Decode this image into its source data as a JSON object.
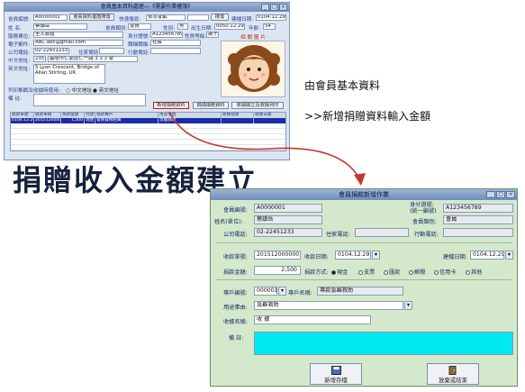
{
  "small_window": {
    "title": "會員基本資料處理---《需要作業權限》",
    "member_no_label": "會員編號:",
    "member_no": "A0000001",
    "query_button": "會員資料進階搜尋",
    "search_label": "快速搜尋:",
    "search_value": "依本會編",
    "edit_button": "搜尋",
    "created_label": "建檔日期:",
    "created_date": "0104.12.29",
    "name_label": "姓 名:",
    "name_value": "蔡鎮岳",
    "type_label": "會員類別:",
    "type_value": "會員",
    "gender_label": "性別:",
    "gender_value": "男",
    "birth_label": "出生日期:",
    "birth_value": "0050.12.29",
    "age_label": "年齡:",
    "age_value": "54",
    "company_label": "服務單位:",
    "company_value": "全大軟體",
    "id_label": "身分證號:",
    "id_value": "A123456789",
    "unit_title_label": "性質等級:",
    "unit_title_value": "謝子金",
    "email_label": "電子郵件:",
    "email_value": "ABC.abc@gmail.com",
    "title_label": "職稱職稱:",
    "title_value": "社長",
    "office_tel_label": "公司電話:",
    "office_tel_value": "02-22451233",
    "home_tel_label": "住家電話:",
    "mobile_label": "行動電話:",
    "zip_label": "中文地址:",
    "zip_value": "235",
    "address_value": "基隆市仁愛區仁一路 3 3 3 號",
    "en_address_label": "英文地址:",
    "en_address_value": "5 Lyon Crescent, Bridge of Allan Stirling, UK",
    "print_label": "列印郵戳及收據時使用:",
    "print_options": [
      "中文地址",
      "英文地址"
    ],
    "note_label": "備 註:",
    "photo_label": "相 關 圖 片",
    "tab_buttons": [
      "新增捐贈資料",
      "捐捐捐贈資料",
      "收據開立及收據列印"
    ],
    "table_headers": [
      "收款單號",
      "收款單據",
      "捐款金額",
      "付款",
      "捐款專戶",
      "用途事由",
      "收據抬頭",
      "收據日期"
    ],
    "table_row": [
      "0104.12.29",
      "2015120000",
      "1,500",
      "現金",
      "會員會務經費",
      "急難救助",
      "",
      ""
    ]
  },
  "annotations": {
    "line1": "由會員基本資料",
    "line2": ">>新增捐贈資料輸入金額",
    "big_title": "捐贈收入金額建立"
  },
  "large_window": {
    "title": "會員捐款新增作業",
    "member_no_label": "會員編號:",
    "member_no": "A0000001",
    "id_label": "身分證號:\n(統一編號)",
    "id_value": "A123456789",
    "name_label": "姓名(單位):",
    "name_value": "蔡鎮岳",
    "type_label": "會員類別:",
    "type_value": "會員",
    "office_tel_label": "公司電話:",
    "office_tel_value": "02-22451233",
    "home_tel_label": "住家電話:",
    "mobile_label": "行動電話:",
    "receipt_no_label": "收款單號:",
    "receipt_no": "2015120000001",
    "receipt_date_label": "收款日期:",
    "receipt_date": "0104.12.29",
    "created_label": "建檔日期:",
    "created_date": "0104.12.29",
    "amount_label": "捐款金額:",
    "amount": "2,500",
    "method_label": "捐款方式:",
    "methods": [
      "現金",
      "支票",
      "匯款",
      "郵撥",
      "信用卡",
      "其他"
    ],
    "selected_method": "現金",
    "account_no_label": "專戶編號:",
    "account_no": "000001",
    "account_name_label": "專戶名稱:",
    "account_name": "專款急難救助",
    "purpose_label": "用途事由:",
    "purpose": "急難救助",
    "receipt_title_label": "收據名稱:",
    "receipt_title": "收 據",
    "note_label": "備 註:",
    "note_value": "",
    "save_button": "新增存檔",
    "close_button": "放棄或結束"
  },
  "colors": {
    "small_window_bg": "#dbe6f2",
    "large_window_bg": "#d4e9cc",
    "note_field": "#00e8f0",
    "arrow": "#c0392b",
    "highlight_border": "#c01818"
  }
}
